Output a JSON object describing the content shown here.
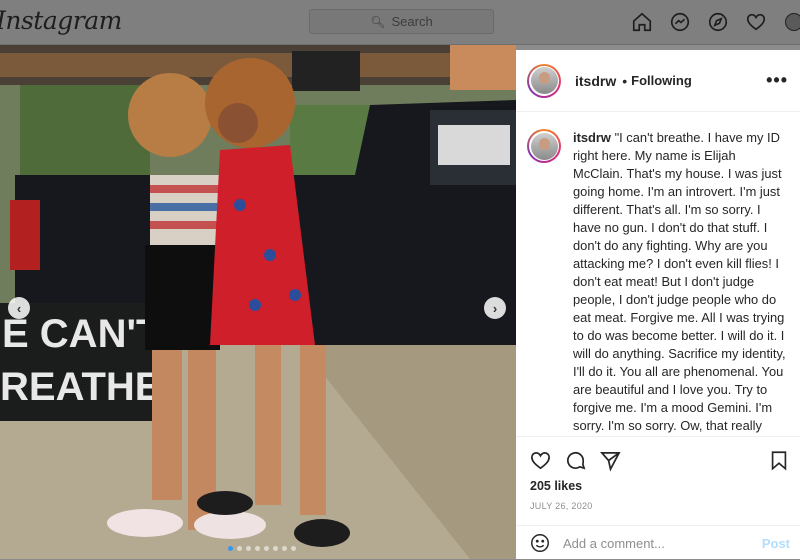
{
  "nav": {
    "logo": "Instagram",
    "search_placeholder": "Search",
    "icons": [
      "home-icon",
      "messenger-icon",
      "explore-icon",
      "heart-icon",
      "profile-avatar"
    ]
  },
  "photo": {
    "sign_line1": "E CAN'T",
    "sign_line2": "REATHE",
    "carousel_count": 8,
    "carousel_active": 0
  },
  "post": {
    "username": "itsdrw",
    "separator": "•",
    "follow_status": "Following",
    "more": "•••",
    "caption_user": "itsdrw",
    "caption_text": "\"I can't breathe. I have my ID right here. My name is Elijah McClain. That's my house. I was just going home. I'm an introvert. I'm just different. That's all. I'm so sorry. I have no gun. I don't do that stuff. I don't do any fighting. Why are you attacking me? I don't even kill flies! I don't eat meat! But I don't judge people, I don't judge people who do eat meat. Forgive me. All I was trying to do was become better. I will do it. I will do anything. Sacrifice my identity, I'll do it. You all are phenomenal. You are beautiful and I love you. Try to forgive me. I'm a mood Gemini. I'm sorry. I'm so sorry. Ow, that really hurt. You are all very strong. Teamwork makes the dream work. Oh, I'm sorry I wasn't trying to do that. I just can't breathe",
    "likes": "205 likes",
    "date": "JULY 26, 2020",
    "comment_placeholder": "Add a comment...",
    "post_label": "Post"
  },
  "colors": {
    "post_button": "#b2dffc",
    "carousel_active": "#3797f0"
  }
}
